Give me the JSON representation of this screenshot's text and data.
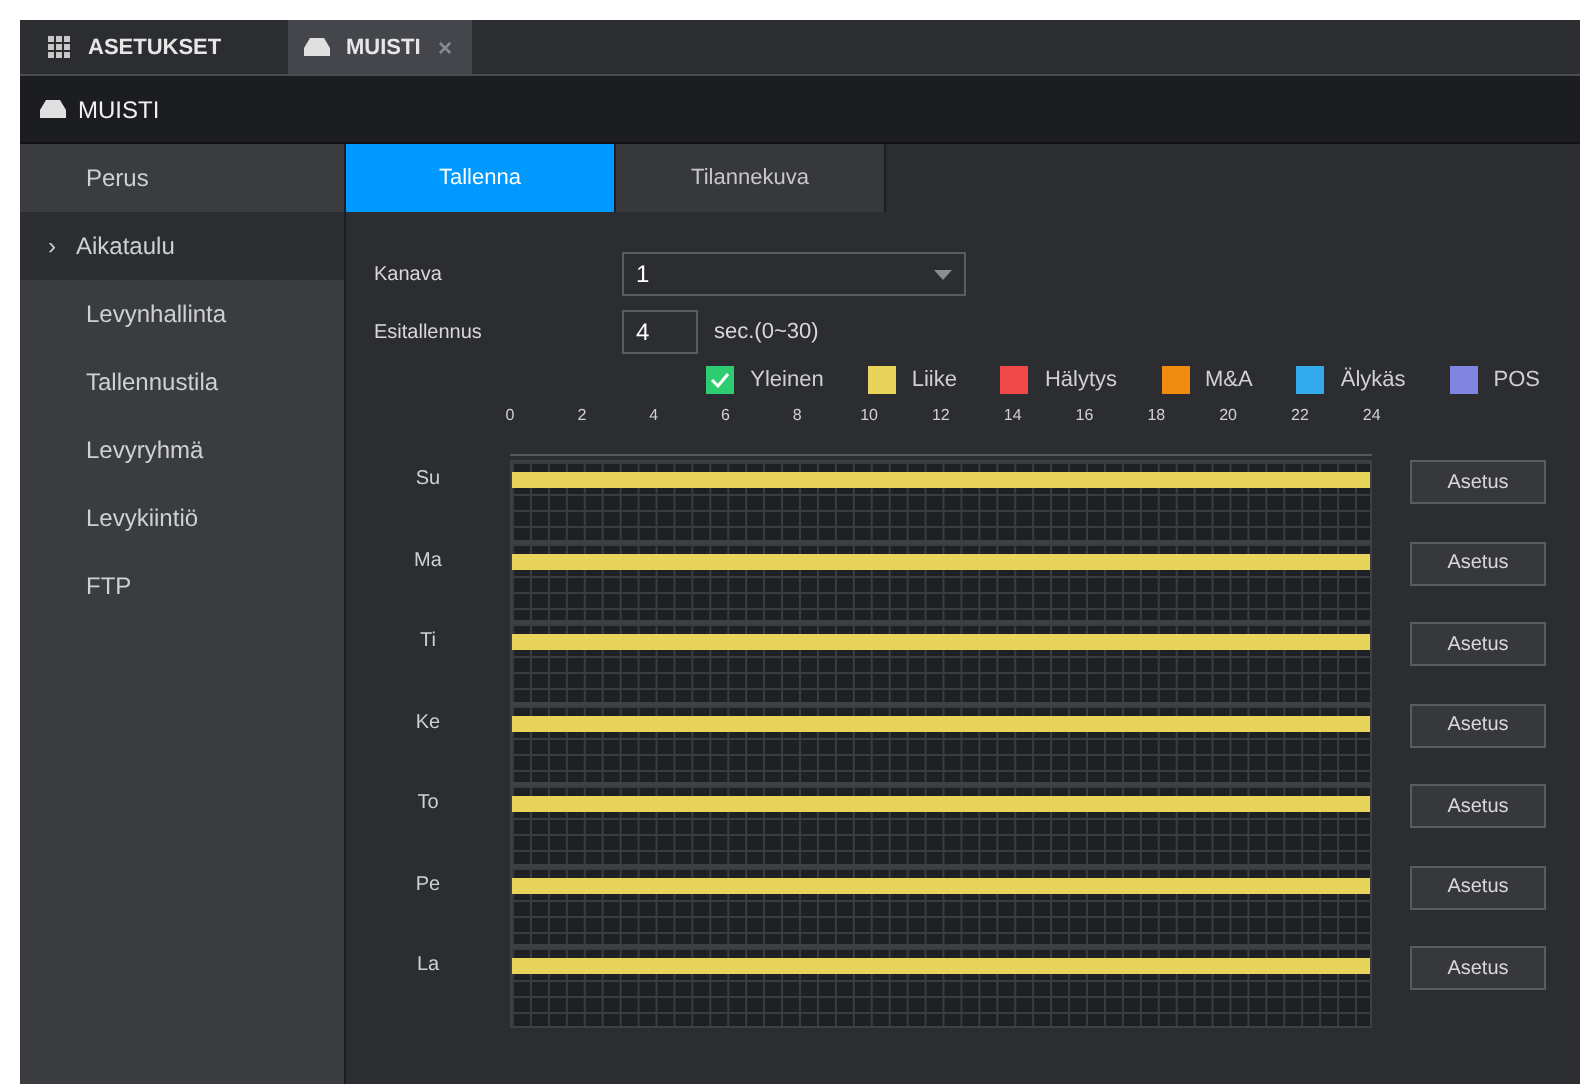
{
  "top_tabs": [
    {
      "label": "ASETUKSET",
      "kind": "grid",
      "selected": false,
      "closable": false
    },
    {
      "label": "MUISTI",
      "kind": "disk",
      "selected": true,
      "closable": true
    }
  ],
  "close_glyph": "×",
  "header": {
    "title": "MUISTI"
  },
  "sidebar": {
    "items": [
      {
        "label": "Perus",
        "selected": false
      },
      {
        "label": "Aikataulu",
        "selected": true
      },
      {
        "label": "Levynhallinta",
        "selected": false
      },
      {
        "label": "Tallennustila",
        "selected": false
      },
      {
        "label": "Levyryhmä",
        "selected": false
      },
      {
        "label": "Levykiintiö",
        "selected": false
      },
      {
        "label": "FTP",
        "selected": false
      }
    ],
    "chevron": "›"
  },
  "tabs": [
    {
      "label": "Tallenna",
      "selected": true
    },
    {
      "label": "Tilannekuva",
      "selected": false
    }
  ],
  "form": {
    "channel": {
      "label": "Kanava",
      "value": "1"
    },
    "prerecord": {
      "label": "Esitallennus",
      "value": "4",
      "unit": "sec.(0~30)"
    }
  },
  "legend": [
    {
      "label": "Yleinen",
      "kind": "general",
      "color": "#2ecc71",
      "checked": true
    },
    {
      "label": "Liike",
      "kind": "motion",
      "color": "#e8d45a",
      "checked": false
    },
    {
      "label": "Hälytys",
      "kind": "alarm",
      "color": "#f04848",
      "checked": false
    },
    {
      "label": "M&A",
      "kind": "ma",
      "color": "#f08c10",
      "checked": false
    },
    {
      "label": "Älykäs",
      "kind": "smart",
      "color": "#33aaf0",
      "checked": false
    },
    {
      "label": "POS",
      "kind": "pos",
      "color": "#7f85e0",
      "checked": false
    }
  ],
  "hours": [
    "0",
    "2",
    "4",
    "6",
    "8",
    "10",
    "12",
    "14",
    "16",
    "18",
    "20",
    "22",
    "24"
  ],
  "days": [
    {
      "label": "Su",
      "kind": "motion",
      "button": "Asetus"
    },
    {
      "label": "Ma",
      "kind": "motion",
      "button": "Asetus"
    },
    {
      "label": "Ti",
      "kind": "motion",
      "button": "Asetus"
    },
    {
      "label": "Ke",
      "kind": "motion",
      "button": "Asetus"
    },
    {
      "label": "To",
      "kind": "motion",
      "button": "Asetus"
    },
    {
      "label": "Pe",
      "kind": "motion",
      "button": "Asetus"
    },
    {
      "label": "La",
      "kind": "motion",
      "button": "Asetus"
    }
  ]
}
